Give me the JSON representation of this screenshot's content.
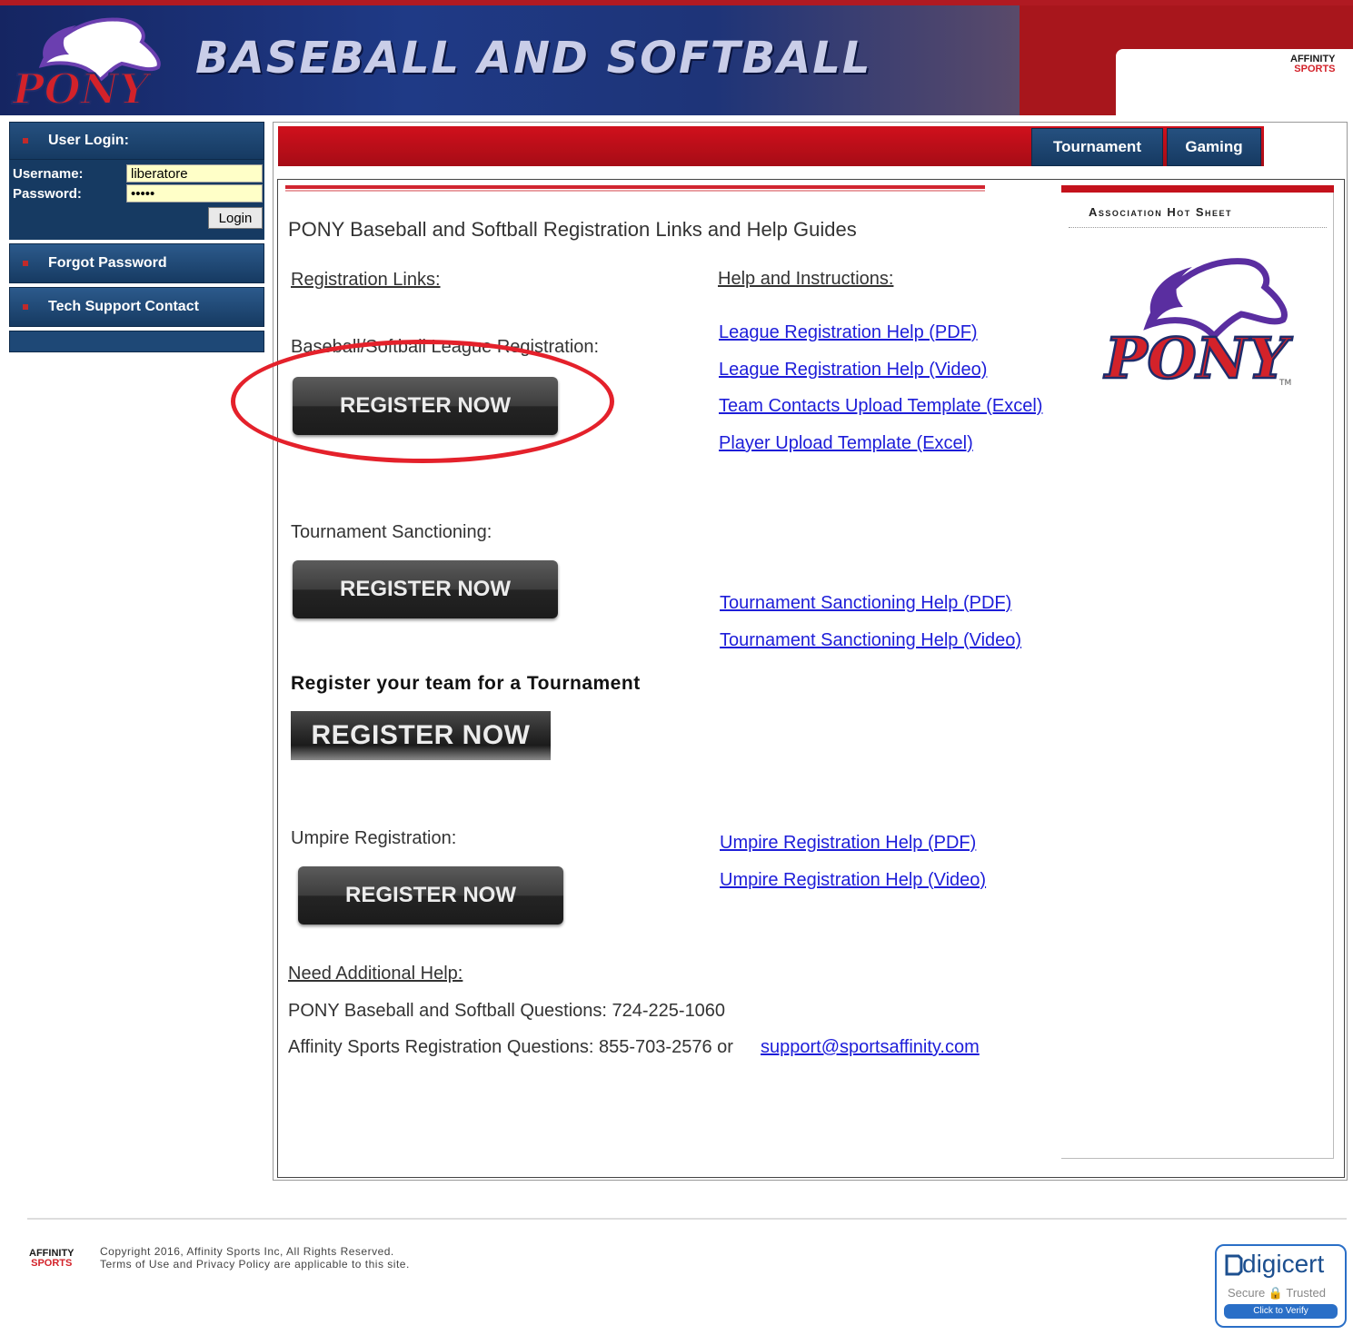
{
  "header": {
    "title": "BASEBALL AND SOFTBALL",
    "logo_text": "PONY",
    "affinity_logo": [
      "AFFINITY",
      "SPORTS"
    ]
  },
  "sidebar": {
    "login_title": "User Login:",
    "username_label": "Username:",
    "username_value": "liberatore",
    "password_label": "Password:",
    "password_value": "•••••",
    "login_button": "Login",
    "items": [
      {
        "label": "Forgot Password"
      },
      {
        "label": "Tech Support Contact"
      }
    ]
  },
  "tabs": [
    {
      "label": "Tournament"
    },
    {
      "label": "Gaming"
    }
  ],
  "main": {
    "page_title": "PONY Baseball and Softball Registration Links and Help Guides",
    "registration_links_heading": "Registration Links:",
    "help_heading": "Help and Instructions:",
    "sections": [
      {
        "label": "Baseball/Softball League Registration:",
        "button": "REGISTER NOW"
      },
      {
        "label": "Tournament Sanctioning:",
        "button": "REGISTER NOW"
      },
      {
        "label": "Register your team for a Tournament",
        "button": "REGISTER NOW"
      },
      {
        "label": "Umpire Registration:",
        "button": "REGISTER NOW"
      }
    ],
    "help_links": [
      "League Registration Help (PDF)",
      "League Registration Help (Video)",
      "Team Contacts Upload Template (Excel)",
      "Player Upload Template (Excel)",
      "Tournament Sanctioning Help (PDF)",
      "Tournament Sanctioning Help (Video)",
      "Umpire Registration Help (PDF)",
      "Umpire Registration Help (Video)"
    ],
    "need_help_heading": "Need Additional Help:",
    "pony_questions": "PONY Baseball and Softball Questions: 724-225-1060",
    "affinity_questions": "Affinity Sports Registration Questions: 855-703-2576 or",
    "support_email": "support@sportsaffinity.com"
  },
  "hot_sheet": {
    "title": "Association Hot Sheet",
    "logo_text": "PONY",
    "tm": "TM"
  },
  "footer": {
    "logo": [
      "AFFINITY",
      "SPORTS"
    ],
    "copyright": "Copyright 2016, Affinity Sports Inc, All Rights Reserved.",
    "terms": "Terms of Use and Privacy Policy are applicable to this site.",
    "digicert_name": "digicert",
    "digicert_sub": "Secure 🔒 Trusted",
    "digicert_verify": "Click to Verify"
  },
  "colors": {
    "header_blue": "#1f3a86",
    "header_red": "#a8161c",
    "nav_blue": "#163a62",
    "link_blue": "#1d1dd9",
    "annotation_red": "#e4212b"
  }
}
